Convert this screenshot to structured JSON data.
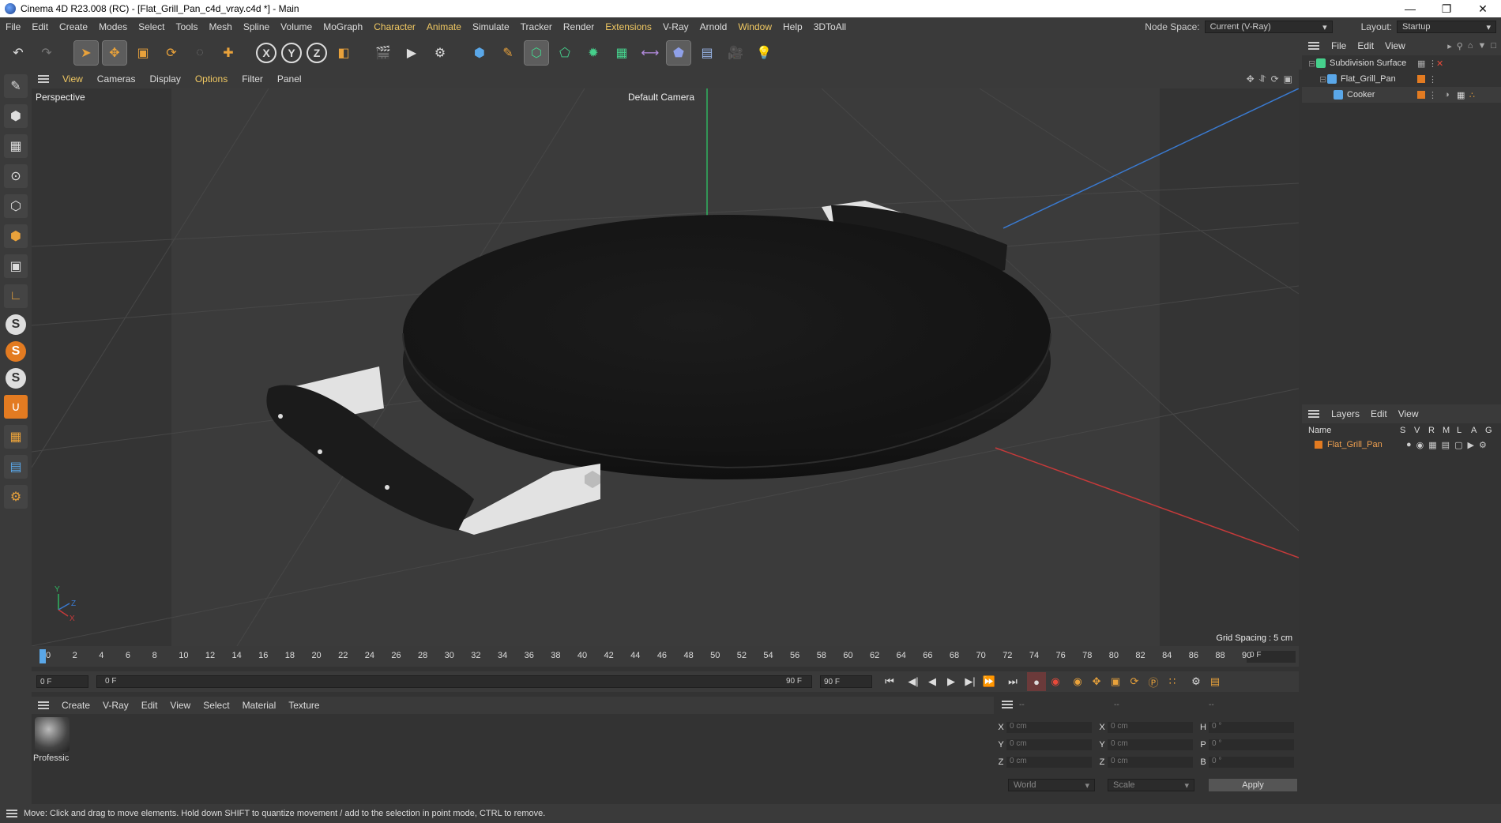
{
  "window": {
    "title": "Cinema 4D R23.008 (RC) - [Flat_Grill_Pan_c4d_vray.c4d *] - Main"
  },
  "menubar": {
    "items": [
      "File",
      "Edit",
      "Create",
      "Modes",
      "Select",
      "Tools",
      "Mesh",
      "Spline",
      "Volume",
      "MoGraph",
      "Character",
      "Animate",
      "Simulate",
      "Tracker",
      "Render",
      "Extensions",
      "V-Ray",
      "Arnold",
      "Window",
      "Help",
      "3DToAll"
    ],
    "node_space_label": "Node Space:",
    "node_space_value": "Current (V-Ray)",
    "layout_label": "Layout:",
    "layout_value": "Startup"
  },
  "viewport": {
    "menu": [
      "View",
      "Cameras",
      "Display",
      "Options",
      "Filter",
      "Panel"
    ],
    "label": "Perspective",
    "camera": "Default Camera",
    "grid_spacing": "Grid Spacing : 5 cm",
    "axis_labels": {
      "y": "Y",
      "z": "Z",
      "x": "X"
    }
  },
  "timeline": {
    "ticks": [
      "0",
      "2",
      "4",
      "6",
      "8",
      "10",
      "12",
      "14",
      "16",
      "18",
      "20",
      "22",
      "24",
      "26",
      "28",
      "30",
      "32",
      "34",
      "36",
      "38",
      "40",
      "42",
      "44",
      "46",
      "48",
      "50",
      "52",
      "54",
      "56",
      "58",
      "60",
      "62",
      "64",
      "66",
      "68",
      "70",
      "72",
      "74",
      "76",
      "78",
      "80",
      "82",
      "84",
      "86",
      "88",
      "90"
    ],
    "current_frame": "0 F"
  },
  "playbar": {
    "start": "0 F",
    "range_start": "0 F",
    "range_end": "90 F",
    "end": "90 F"
  },
  "materials": {
    "menu": [
      "Create",
      "V-Ray",
      "Edit",
      "View",
      "Select",
      "Material",
      "Texture"
    ],
    "items": [
      {
        "name": "Professic"
      }
    ]
  },
  "coords": {
    "header": [
      "--",
      "--",
      "--"
    ],
    "rows": [
      {
        "a": "X",
        "av": "0 cm",
        "b": "X",
        "bv": "0 cm",
        "c": "H",
        "cv": "0 °"
      },
      {
        "a": "Y",
        "av": "0 cm",
        "b": "Y",
        "bv": "0 cm",
        "c": "P",
        "cv": "0 °"
      },
      {
        "a": "Z",
        "av": "0 cm",
        "b": "Z",
        "bv": "0 cm",
        "c": "B",
        "cv": "0 °"
      }
    ],
    "world": "World",
    "scale": "Scale",
    "apply": "Apply"
  },
  "objects": {
    "menu": [
      "File",
      "Edit",
      "View"
    ],
    "items": [
      {
        "name": "Subdivision Surface"
      },
      {
        "name": "Flat_Grill_Pan"
      },
      {
        "name": "Cooker"
      }
    ]
  },
  "layers": {
    "menu": [
      "Layers",
      "Edit",
      "View"
    ],
    "columns": [
      "Name",
      "S",
      "V",
      "R",
      "M",
      "L",
      "A",
      "G"
    ],
    "items": [
      {
        "name": "Flat_Grill_Pan"
      }
    ]
  },
  "status": {
    "text": "Move: Click and drag to move elements. Hold down SHIFT to quantize movement / add to the selection in point mode, CTRL to remove."
  },
  "colors": {
    "accent": "#f0c862",
    "layer": "#e37b21",
    "bg": "#333333"
  }
}
